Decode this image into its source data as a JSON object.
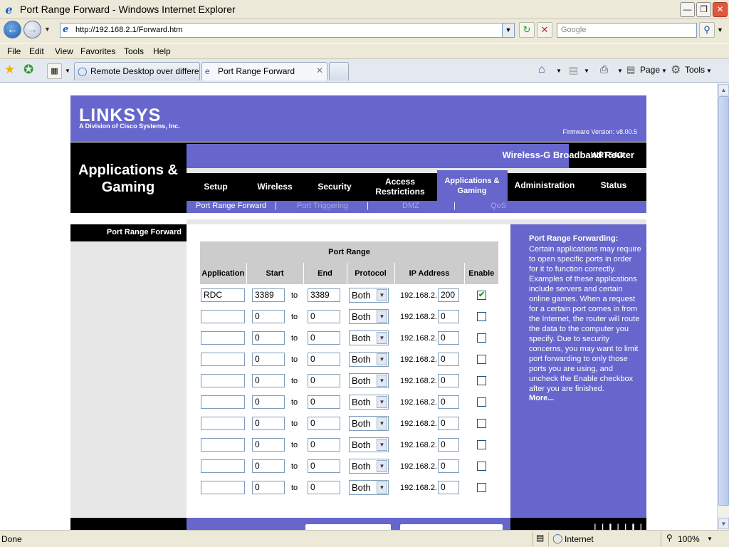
{
  "window": {
    "title": "Port Range Forward - Windows Internet Explorer"
  },
  "toolbar": {
    "url": "http://192.168.2.1/Forward.htm",
    "search_placeholder": "Google"
  },
  "menu": [
    "File",
    "Edit",
    "View",
    "Favorites",
    "Tools",
    "Help"
  ],
  "tabs": [
    {
      "label": "Remote Desktop over differe...",
      "active": false
    },
    {
      "label": "Port Range Forward",
      "active": true
    }
  ],
  "command_bar": {
    "page": "Page",
    "tools": "Tools"
  },
  "router": {
    "brand": "LINKSYS",
    "brand_sub": "A Division of Cisco Systems, Inc.",
    "firmware": "Firmware Version: v8.00.5",
    "section": "Applications & Gaming",
    "product": "Wireless-G Broadband Router",
    "model": "WRT54G",
    "nav": [
      "Setup",
      "Wireless",
      "Security",
      "Access Restrictions",
      "Applications & Gaming",
      "Administration",
      "Status"
    ],
    "subnav": [
      "Port Range Forward",
      "Port Triggering",
      "DMZ",
      "QoS"
    ],
    "left_label": "Port Range Forward",
    "table": {
      "group_header": "Port Range",
      "headers": [
        "Application",
        "Start",
        "End",
        "Protocol",
        "IP Address",
        "Enable"
      ],
      "to_label": "to",
      "ip_prefix": "192.168.2.",
      "rows": [
        {
          "app": "RDC",
          "start": "3389",
          "end": "3389",
          "protocol": "Both",
          "ip": "200",
          "enabled": true
        },
        {
          "app": "",
          "start": "0",
          "end": "0",
          "protocol": "Both",
          "ip": "0",
          "enabled": false
        },
        {
          "app": "",
          "start": "0",
          "end": "0",
          "protocol": "Both",
          "ip": "0",
          "enabled": false
        },
        {
          "app": "",
          "start": "0",
          "end": "0",
          "protocol": "Both",
          "ip": "0",
          "enabled": false
        },
        {
          "app": "",
          "start": "0",
          "end": "0",
          "protocol": "Both",
          "ip": "0",
          "enabled": false
        },
        {
          "app": "",
          "start": "0",
          "end": "0",
          "protocol": "Both",
          "ip": "0",
          "enabled": false
        },
        {
          "app": "",
          "start": "0",
          "end": "0",
          "protocol": "Both",
          "ip": "0",
          "enabled": false
        },
        {
          "app": "",
          "start": "0",
          "end": "0",
          "protocol": "Both",
          "ip": "0",
          "enabled": false
        },
        {
          "app": "",
          "start": "0",
          "end": "0",
          "protocol": "Both",
          "ip": "0",
          "enabled": false
        },
        {
          "app": "",
          "start": "0",
          "end": "0",
          "protocol": "Both",
          "ip": "0",
          "enabled": false
        }
      ]
    },
    "help": {
      "title": "Port Range Forwarding:",
      "text": "Certain applications may require to open specific ports in order for it to function correctly. Examples of these applications include servers and certain online games. When a request for a certain port comes in from the Internet, the router will route the data to the computer you specify. Due to security concerns, you may want to limit port forwarding to only those ports you are using, and uncheck the Enable checkbox after you are finished.",
      "more": "More..."
    }
  },
  "statusbar": {
    "status": "Done",
    "zone": "Internet",
    "zoom": "100%"
  },
  "colors": {
    "linksys_purple": "#6666cc",
    "black": "#000000",
    "table_header": "#cccccc"
  }
}
